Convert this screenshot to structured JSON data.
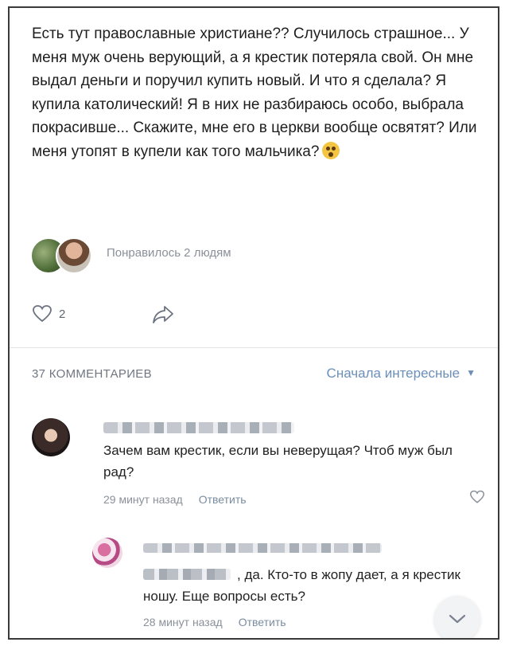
{
  "post": {
    "text": "Есть тут православные христиане?? Случилось страшное... У меня муж очень верующий, а я крестик потеряла свой. Он мне выдал деньги и поручил купить новый. И что я сделала? Я купила католический! Я в них не разбираюсь особо, выбрала покрасивше... Скажите, мне его в церкви вообще освятят? Или меня утопят в купели как того мальчика?",
    "emoji_icon": "flushed-face-icon",
    "likes_text": "Понравилось 2 людям",
    "like_count": "2"
  },
  "comments_header": {
    "count_label": "37 КОММЕНТАРИЕВ",
    "sort_label": "Сначала интересные"
  },
  "comments": [
    {
      "text": "Зачем вам крестик, если вы неверущая? Чтоб муж был рад?",
      "time": "29 минут назад",
      "reply": "Ответить"
    },
    {
      "text": ", да. Кто-то в жопу дает, а я крестик ношу. Еще вопросы есть?",
      "time": "28 минут назад",
      "reply": "Ответить"
    }
  ],
  "colors": {
    "accent": "#6c8fb8",
    "muted": "#8a9099"
  }
}
